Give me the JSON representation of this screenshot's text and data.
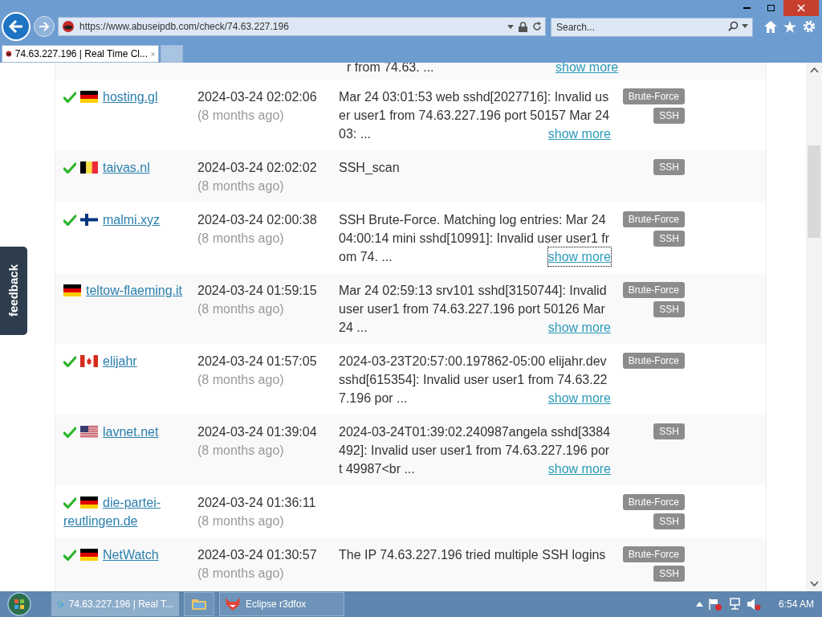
{
  "browser": {
    "address": "https://www.abuseipdb.com/check/74.63.227.196",
    "search_placeholder": "Search...",
    "tabs": [
      {
        "title": "74.63.227.196 | Real Time Cl...",
        "selected": true
      }
    ]
  },
  "partial_row": {
    "comment": "r from 74.63. ...",
    "link": "show more"
  },
  "reports": [
    {
      "verified": true,
      "flag": {
        "kind": "de"
      },
      "reporter": "hosting.gl",
      "date": "2024-03-24 02:02:06",
      "age": "(8 months ago)",
      "comment": "Mar 24 03:01:53 web sshd[2027716]: Invalid user user1 from 74.63.227.196 port 50157 Mar 24 03: ...",
      "show_more": "show more",
      "focused": false,
      "categories": [
        "Brute-Force",
        "SSH"
      ]
    },
    {
      "verified": true,
      "flag": {
        "kind": "be"
      },
      "reporter": "taivas.nl",
      "date": "2024-03-24 02:02:02",
      "age": "(8 months ago)",
      "comment": "SSH_scan",
      "categories": [
        "SSH"
      ]
    },
    {
      "verified": true,
      "flag": {
        "kind": "fi"
      },
      "reporter": "malmi.xyz",
      "date": "2024-03-24 02:00:38",
      "age": "(8 months ago)",
      "comment": "SSH Brute-Force. Matching log entries: Mar 24 04:00:14 mini sshd[10991]: Invalid user user1 from 74. ...",
      "show_more": "show more",
      "focused": true,
      "categories": [
        "Brute-Force",
        "SSH"
      ]
    },
    {
      "verified": false,
      "flag": {
        "kind": "de"
      },
      "reporter": "teltow-flaeming.it",
      "date": "2024-03-24 01:59:15",
      "age": "(8 months ago)",
      "comment": "Mar 24 02:59:13 srv101 sshd[3150744]: Invalid user user1 from 74.63.227.196 port 50126 Mar 24 ...",
      "show_more": "show more",
      "focused": false,
      "categories": [
        "Brute-Force",
        "SSH"
      ]
    },
    {
      "verified": true,
      "flag": {
        "kind": "ca"
      },
      "reporter": "elijahr",
      "date": "2024-03-24 01:57:05",
      "age": "(8 months ago)",
      "comment": "2024-03-23T20:57:00.197862-05:00 elijahr.dev sshd[615354]: Invalid user user1 from 74.63.227.196 por ...",
      "show_more": "show more",
      "focused": false,
      "categories": [
        "Brute-Force"
      ]
    },
    {
      "verified": true,
      "flag": {
        "kind": "us"
      },
      "reporter": "lavnet.net",
      "date": "2024-03-24 01:39:04",
      "age": "(8 months ago)",
      "comment": "2024-03-24T01:39:02.240987angela sshd[3384492]: Invalid user user1 from 74.63.227.196 port 49987<br ...",
      "show_more": "show more",
      "focused": false,
      "categories": [
        "SSH"
      ]
    },
    {
      "verified": true,
      "flag": {
        "kind": "de"
      },
      "reporter": "die-partei-reutlingen.de",
      "date": "2024-03-24 01:36:11",
      "age": "(8 months ago)",
      "categories": [
        "Brute-Force",
        "SSH"
      ]
    },
    {
      "verified": true,
      "flag": {
        "kind": "de"
      },
      "reporter": "NetWatch",
      "date": "2024-03-24 01:30:57",
      "age": "(8 months ago)",
      "comment": "The IP 74.63.227.196 tried multiple SSH logins",
      "categories": [
        "Brute-Force",
        "SSH"
      ]
    }
  ],
  "feedback": "feedback",
  "taskbar": {
    "items": [
      {
        "kind": "browser",
        "label": "74.63.227.196 | Real T...",
        "selected": true
      },
      {
        "kind": "folder",
        "selected": false
      },
      {
        "kind": "fox",
        "label": "Eclipse r3dfox",
        "selected": false
      }
    ],
    "clock": "6:54 AM"
  }
}
